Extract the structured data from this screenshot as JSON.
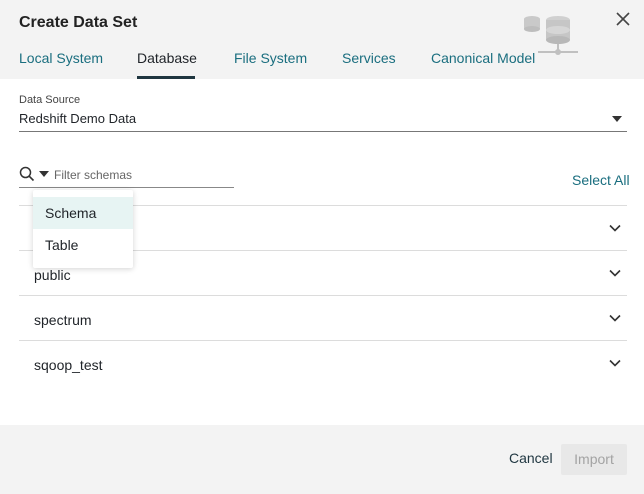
{
  "dialog": {
    "title": "Create Data Set"
  },
  "tabs": [
    {
      "label": "Local System",
      "active": false
    },
    {
      "label": "Database",
      "active": true
    },
    {
      "label": "File System",
      "active": false
    },
    {
      "label": "Services",
      "active": false
    },
    {
      "label": "Canonical Model",
      "active": false
    }
  ],
  "data_source": {
    "label": "Data Source",
    "value": "Redshift Demo Data"
  },
  "filter": {
    "placeholder": "Filter schemas",
    "select_all_label": "Select All"
  },
  "filter_mode_menu": {
    "options": [
      "Schema",
      "Table"
    ],
    "highlighted": "Schema"
  },
  "schemas": [
    {
      "name": "",
      "expanded": false
    },
    {
      "name": "public",
      "expanded": false
    },
    {
      "name": "spectrum",
      "expanded": false
    },
    {
      "name": "sqoop_test",
      "expanded": false
    }
  ],
  "footer": {
    "cancel_label": "Cancel",
    "import_label": "Import",
    "import_enabled": false
  },
  "colors": {
    "accent": "#1a6e7f",
    "header_bg": "#f3f3f3",
    "menu_highlight": "#e7f4f3"
  }
}
